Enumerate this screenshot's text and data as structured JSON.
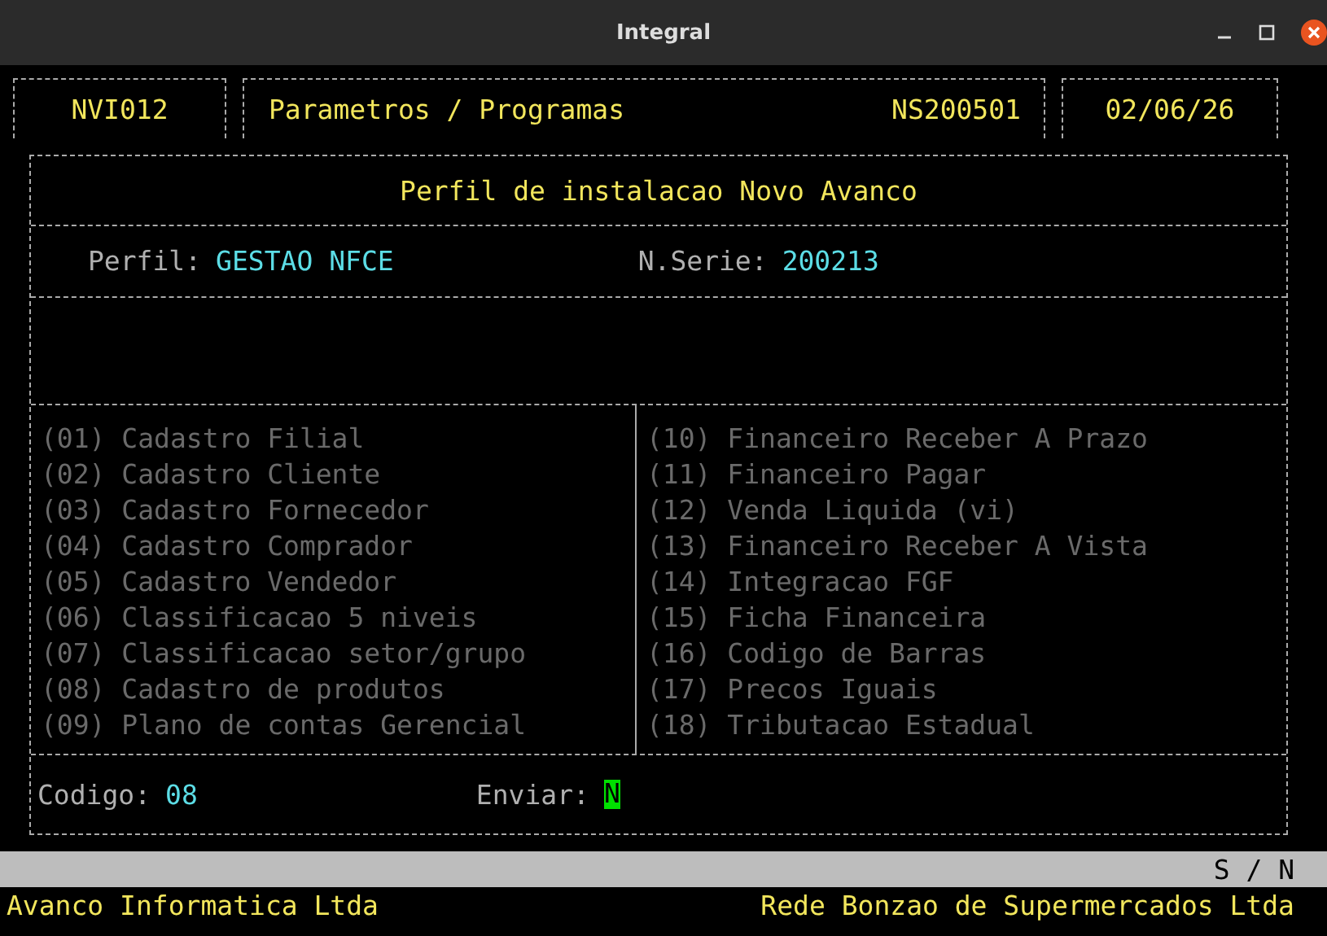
{
  "window": {
    "title": "Integral"
  },
  "header": {
    "program_code": "NVI012",
    "module": "Parametros / Programas",
    "serial": "NS200501",
    "date": "02/06/26"
  },
  "panel": {
    "title": "Perfil de instalacao Novo Avanco",
    "perfil_label": "Perfil:",
    "perfil_value": "GESTAO NFCE",
    "serie_label": "N.Serie:",
    "serie_value": "200213"
  },
  "options_left": [
    "(01) Cadastro Filial",
    "(02) Cadastro Cliente",
    "(03) Cadastro Fornecedor",
    "(04) Cadastro Comprador",
    "(05) Cadastro Vendedor",
    "(06) Classificacao 5 niveis",
    "(07) Classificacao setor/grupo",
    "(08) Cadastro de produtos",
    "(09) Plano de contas Gerencial"
  ],
  "options_right": [
    "(10) Financeiro Receber A Prazo",
    "(11) Financeiro Pagar",
    "(12) Venda Liquida (vi)",
    "(13) Financeiro Receber A Vista",
    "(14) Integracao FGF",
    "(15) Ficha Financeira",
    "(16) Codigo de Barras",
    "(17) Precos Iguais",
    "(18) Tributacao Estadual"
  ],
  "form": {
    "codigo_label": "Codigo:",
    "codigo_value": "08",
    "enviar_label": "Enviar:",
    "enviar_value": "N"
  },
  "hint_bar": "S / N",
  "footer": {
    "left": "Avanco Informatica Ltda",
    "right": "Rede Bonzao de Supermercados Ltda"
  }
}
